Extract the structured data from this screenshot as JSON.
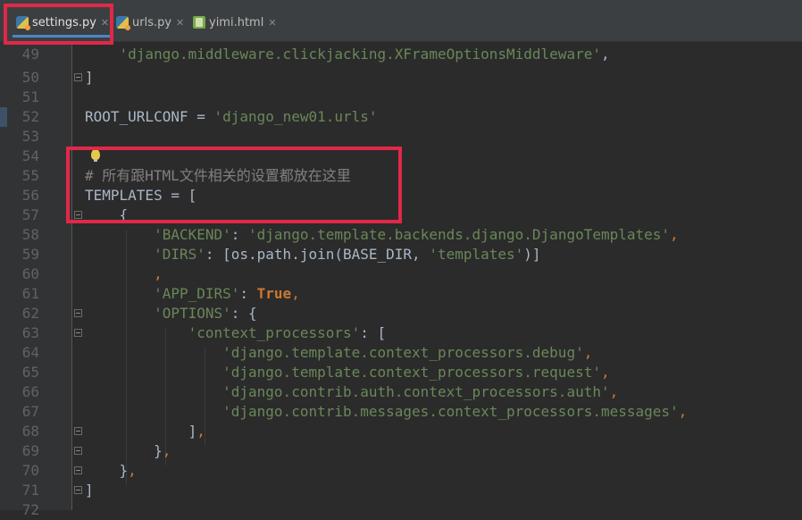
{
  "tabs": [
    {
      "label": "settings.py",
      "icon": "python-file-icon",
      "active": true
    },
    {
      "label": "urls.py",
      "icon": "python-file-icon",
      "active": false
    },
    {
      "label": "yimi.html",
      "icon": "html-file-icon",
      "active": false
    }
  ],
  "close_glyph": "✕",
  "colors": {
    "background": "#2b2b2b",
    "keyword": "#cc7832",
    "string": "#6a8759",
    "comment": "#808080",
    "text": "#a9b7c6",
    "highlight_box": "#e02848"
  },
  "lines": [
    {
      "number": "49",
      "text": "    'django.middleware.clickjacking.XFrameOptionsMiddleware',"
    },
    {
      "number": "50",
      "text": "]"
    },
    {
      "number": "51",
      "text": ""
    },
    {
      "number": "52",
      "text": "ROOT_URLCONF = 'django_new01.urls'"
    },
    {
      "number": "53",
      "text": ""
    },
    {
      "number": "54",
      "text": ""
    },
    {
      "number": "55",
      "text": "# 所有跟HTML文件相关的设置都放在这里"
    },
    {
      "number": "56",
      "text": "TEMPLATES = ["
    },
    {
      "number": "57",
      "text": "    {"
    },
    {
      "number": "58",
      "text": "        'BACKEND': 'django.template.backends.django.DjangoTemplates',"
    },
    {
      "number": "59",
      "text": "        'DIRS': [os.path.join(BASE_DIR, 'templates')]"
    },
    {
      "number": "60",
      "text": "        ,"
    },
    {
      "number": "61",
      "text": "        'APP_DIRS': True,"
    },
    {
      "number": "62",
      "text": "        'OPTIONS': {"
    },
    {
      "number": "63",
      "text": "            'context_processors': ["
    },
    {
      "number": "64",
      "text": "                'django.template.context_processors.debug',"
    },
    {
      "number": "65",
      "text": "                'django.template.context_processors.request',"
    },
    {
      "number": "66",
      "text": "                'django.contrib.auth.context_processors.auth',"
    },
    {
      "number": "67",
      "text": "                'django.contrib.messages.context_processors.messages',"
    },
    {
      "number": "68",
      "text": "            ],"
    },
    {
      "number": "69",
      "text": "        },"
    },
    {
      "number": "70",
      "text": "    },"
    },
    {
      "number": "71",
      "text": "]"
    },
    {
      "number": "72",
      "text": ""
    }
  ]
}
